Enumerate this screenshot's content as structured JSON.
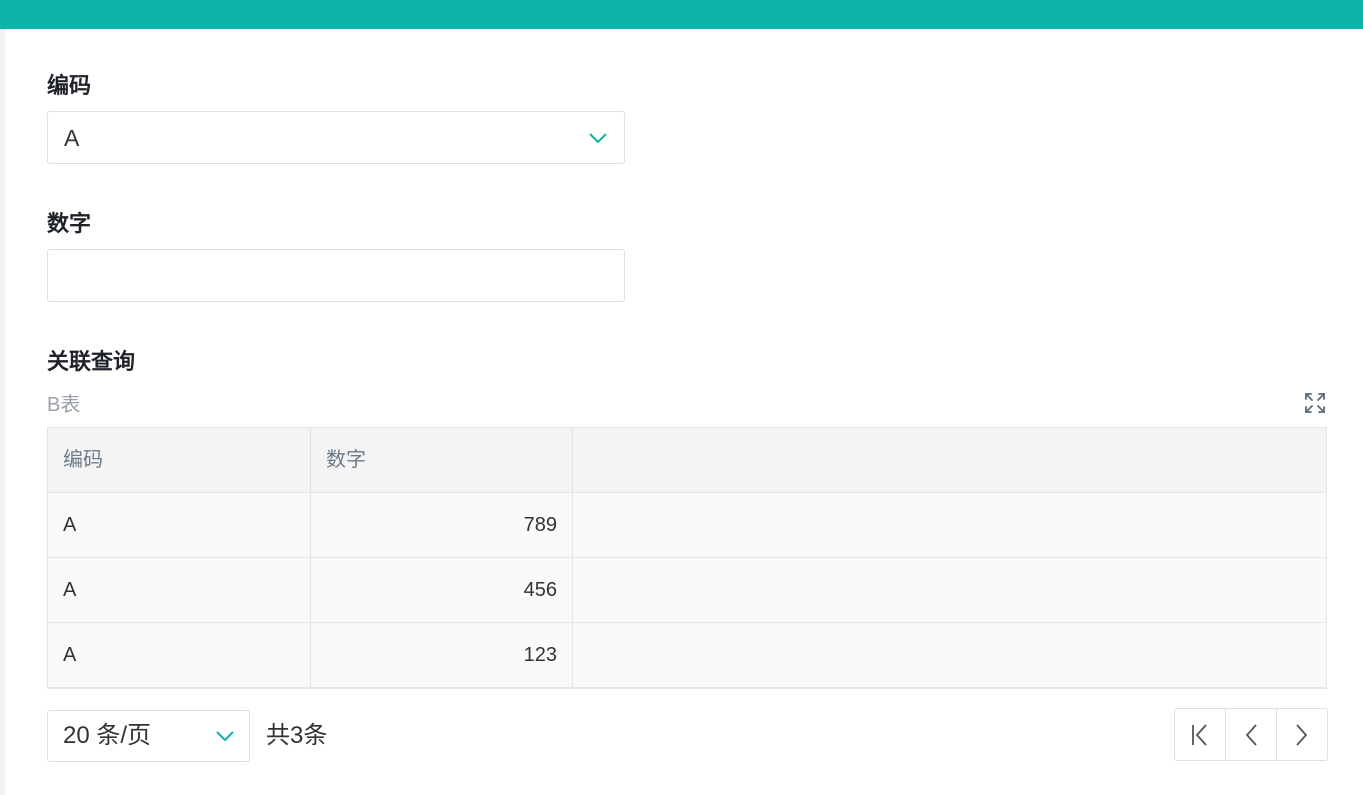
{
  "form": {
    "code_label": "编码",
    "code_value": "A",
    "number_label": "数字",
    "number_value": "",
    "relation_label": "关联查询",
    "relation_subtitle": "B表"
  },
  "table": {
    "columns": [
      "编码",
      "数字",
      ""
    ],
    "rows": [
      {
        "code": "A",
        "number": "789"
      },
      {
        "code": "A",
        "number": "456"
      },
      {
        "code": "A",
        "number": "123"
      }
    ]
  },
  "pagination": {
    "page_size": "20 条/页",
    "total": "共3条"
  },
  "icons": {
    "dropdown": "chevron-down-icon",
    "expand": "fullscreen-expand-icon",
    "first": "first-page-icon",
    "prev": "prev-page-icon",
    "next": "next-page-icon"
  },
  "colors": {
    "brand": "#0db3a6",
    "border": "#dcdfe6",
    "header_bg": "#f4f4f4",
    "header_text": "#6d7a8c"
  }
}
